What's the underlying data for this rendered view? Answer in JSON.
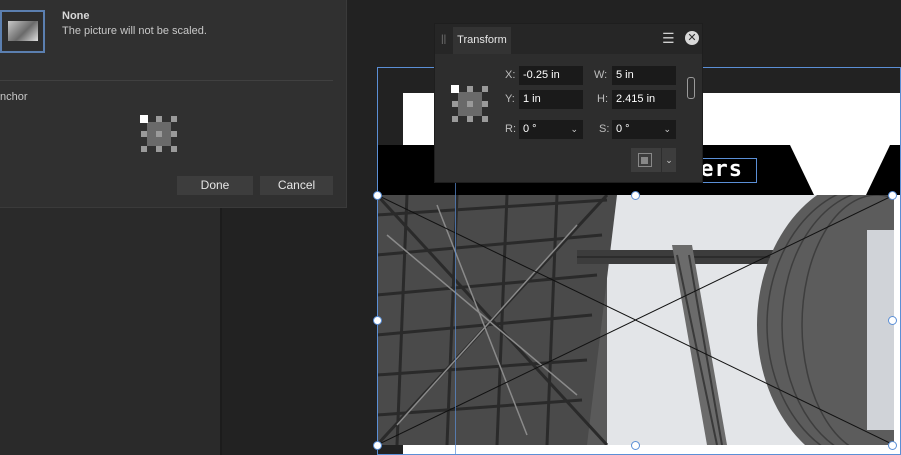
{
  "dialog": {
    "option_title": "None",
    "option_description": "The picture will not be scaled.",
    "anchor_label": "nchor",
    "done_label": "Done",
    "cancel_label": "Cancel"
  },
  "transform": {
    "tab_label": "Transform",
    "menu_icon": "☰",
    "close_icon": "✕",
    "x_label": "X:",
    "x_value": "-0.25 in",
    "y_label": "Y:",
    "y_value": "1 in",
    "w_label": "W:",
    "w_value": "5 in",
    "h_label": "H:",
    "h_value": "2.415 in",
    "r_label": "R:",
    "r_value": "0 °",
    "s_label": "S:",
    "s_value": "0 °",
    "dropdown_arrow": "⌄"
  },
  "document": {
    "banner_text": "vers"
  },
  "colors": {
    "selection": "#5b8fd6",
    "panel": "#2d2d2d",
    "dialog": "#303030"
  }
}
